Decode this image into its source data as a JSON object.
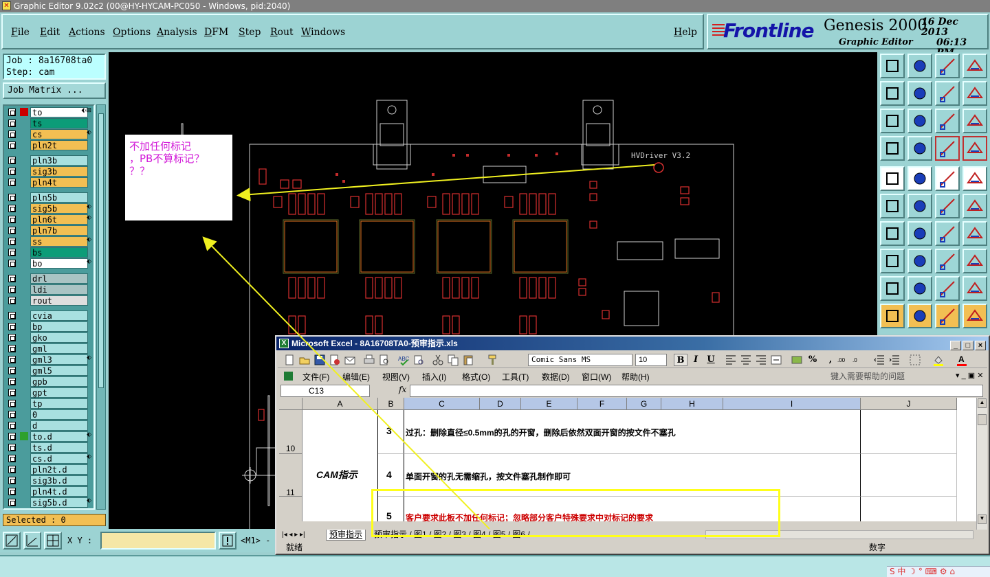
{
  "window": {
    "title": "Graphic Editor 9.02c2 (00@HY-HYCAM-PC050 - Windows, pid:2040)",
    "icon": "app-icon"
  },
  "menu": {
    "file": "File",
    "edit": "Edit",
    "actions": "Actions",
    "options": "Options",
    "analysis": "Analysis",
    "dfm": "DFM",
    "step": "Step",
    "rout": "Rout",
    "windows": "Windows",
    "help": "Help"
  },
  "brand": {
    "logo": "Frontline",
    "product": "Genesis 2000",
    "subtitle": "Graphic Editor",
    "date": "16 Dec 2013",
    "time": "06:13 PM"
  },
  "job": {
    "job_line": "Job : 8a16708ta0",
    "step_line": "Step: cam",
    "matrix_button": "Job Matrix ..."
  },
  "layers": [
    {
      "name": "to",
      "color": "#ffffff",
      "mark": "⬖⊞",
      "ctx": "#cc0000",
      "active": true
    },
    {
      "name": "ts",
      "color": "#0c9c78"
    },
    {
      "name": "cs",
      "color": "#f2bf53",
      "mark": "⬖"
    },
    {
      "name": "pln2t",
      "color": "#f2bf53"
    },
    {
      "name": "pln3b",
      "color": "#a8e0e0"
    },
    {
      "name": "sig3b",
      "color": "#f2bf53"
    },
    {
      "name": "pln4t",
      "color": "#f2bf53"
    },
    {
      "name": "pln5b",
      "color": "#a8e0e0"
    },
    {
      "name": "sig5b",
      "color": "#f2bf53",
      "mark": "⬖"
    },
    {
      "name": "pln6t",
      "color": "#f2bf53",
      "mark": "⬖"
    },
    {
      "name": "pln7b",
      "color": "#f2bf53"
    },
    {
      "name": "ss",
      "color": "#f2bf53",
      "mark": "⬖"
    },
    {
      "name": "bs",
      "color": "#0c9c78"
    },
    {
      "name": "bo",
      "color": "#ffffff",
      "mark": "⬖"
    },
    {
      "name": "drl",
      "color": "#a9c4c4"
    },
    {
      "name": "ldi",
      "color": "#a9c4c4"
    },
    {
      "name": "rout",
      "color": "#dedede"
    },
    {
      "name": "cvia",
      "color": "#a8e0e0"
    },
    {
      "name": "bp",
      "color": "#a8e0e0"
    },
    {
      "name": "gko",
      "color": "#a8e0e0"
    },
    {
      "name": "gml",
      "color": "#a8e0e0"
    },
    {
      "name": "gml3",
      "color": "#a8e0e0",
      "mark": "⬖"
    },
    {
      "name": "gml5",
      "color": "#a8e0e0"
    },
    {
      "name": "gpb",
      "color": "#a8e0e0"
    },
    {
      "name": "gpt",
      "color": "#a8e0e0"
    },
    {
      "name": "tp",
      "color": "#a8e0e0"
    },
    {
      "name": "0",
      "color": "#a8e0e0"
    },
    {
      "name": "d",
      "color": "#a8e0e0"
    },
    {
      "name": "to.d",
      "color": "#a8e0e0",
      "mark": "⬖",
      "ctx": "#2ea02e"
    },
    {
      "name": "ts.d",
      "color": "#a8e0e0"
    },
    {
      "name": "cs.d",
      "color": "#a8e0e0",
      "mark": "⬖"
    },
    {
      "name": "pln2t.d",
      "color": "#a8e0e0"
    },
    {
      "name": "sig3b.d",
      "color": "#a8e0e0"
    },
    {
      "name": "pln4t.d",
      "color": "#a8e0e0"
    },
    {
      "name": "sig5b.d",
      "color": "#a8e0e0",
      "mark": "⬖"
    }
  ],
  "selected": "Selected : 0",
  "board_label": "HVDriver V3.2",
  "note": {
    "line1": "不加任何标记",
    "line2": "，PB不算标记？",
    "line3": "？？"
  },
  "bottom": {
    "xy_label": "X Y :",
    "xy_value": "",
    "mode_label": "<M1> -"
  },
  "excel": {
    "title": "Microsoft Excel - 8A16708TA0-预审指示.xls",
    "font": "Comic Sans MS",
    "size": "10",
    "bold": "B",
    "italic": "I",
    "underline": "U",
    "percent": "%",
    "comma": ",",
    "menus": [
      "文件(F)",
      "编辑(E)",
      "视图(V)",
      "插入(I)",
      "格式(O)",
      "工具(T)",
      "数据(D)",
      "窗口(W)",
      "帮助(H)"
    ],
    "help_placeholder": "键入需要帮助的问题",
    "name_box": "C13",
    "fx": "fx",
    "columns": [
      "A",
      "B",
      "C",
      "D",
      "E",
      "F",
      "G",
      "H",
      "I",
      "J"
    ],
    "rows": [
      {
        "row": "10",
        "num": "3",
        "text": "过孔：删除直径≤0.5mm的孔的开窗，删除后依然双面开窗的按文件不塞孔",
        "color": "#000000"
      },
      {
        "row": "11",
        "num": "4",
        "text": "单面开窗的孔无需缩孔，按文件塞孔制作即可",
        "color": "#000000"
      },
      {
        "row": "",
        "num": "5",
        "text": "客户要求此板不加任何标记；忽略部分客户特殊要求中对标记的要求",
        "color": "#cc0000"
      }
    ],
    "merged_label": "CAM指示",
    "sheet_tabs": "预审指示 / 图1 / 图2 / 图3 / 图4 / 图5 / 图6 /",
    "active_tab": "预审指示",
    "status_left": "就绪",
    "status_right": "数字"
  },
  "tray": "S 中 ☽ ° ⌨ ⚙ ⌂",
  "colors": {
    "highlight": "#ffff1a",
    "arrow": "#f0f020",
    "note_text": "#d21bd8",
    "board_orange": "#e07020",
    "board_red": "#d83030"
  }
}
